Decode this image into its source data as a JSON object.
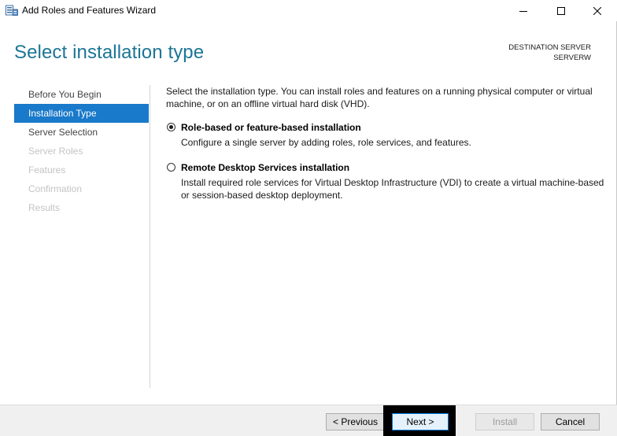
{
  "window": {
    "title": "Add Roles and Features Wizard"
  },
  "header": {
    "title": "Select installation type",
    "destination_label": "DESTINATION SERVER",
    "destination_value": "SERVERW"
  },
  "nav": {
    "items": [
      {
        "label": "Before You Begin",
        "state": "normal"
      },
      {
        "label": "Installation Type",
        "state": "active"
      },
      {
        "label": "Server Selection",
        "state": "normal"
      },
      {
        "label": "Server Roles",
        "state": "disabled"
      },
      {
        "label": "Features",
        "state": "disabled"
      },
      {
        "label": "Confirmation",
        "state": "disabled"
      },
      {
        "label": "Results",
        "state": "disabled"
      }
    ]
  },
  "content": {
    "intro": "Select the installation type. You can install roles and features on a running physical computer or virtual machine, or on an offline virtual hard disk (VHD).",
    "options": [
      {
        "title": "Role-based or feature-based installation",
        "description": "Configure a single server by adding roles, role services, and features.",
        "selected": true
      },
      {
        "title": "Remote Desktop Services installation",
        "description": "Install required role services for Virtual Desktop Infrastructure (VDI) to create a virtual machine-based or session-based desktop deployment.",
        "selected": false
      }
    ]
  },
  "footer": {
    "previous_label": "< Previous",
    "next_label": "Next >",
    "install_label": "Install",
    "cancel_label": "Cancel"
  },
  "colors": {
    "title_accent": "#1c7596",
    "nav_active": "#1979ca",
    "footer_bg": "#f0f0f0"
  }
}
